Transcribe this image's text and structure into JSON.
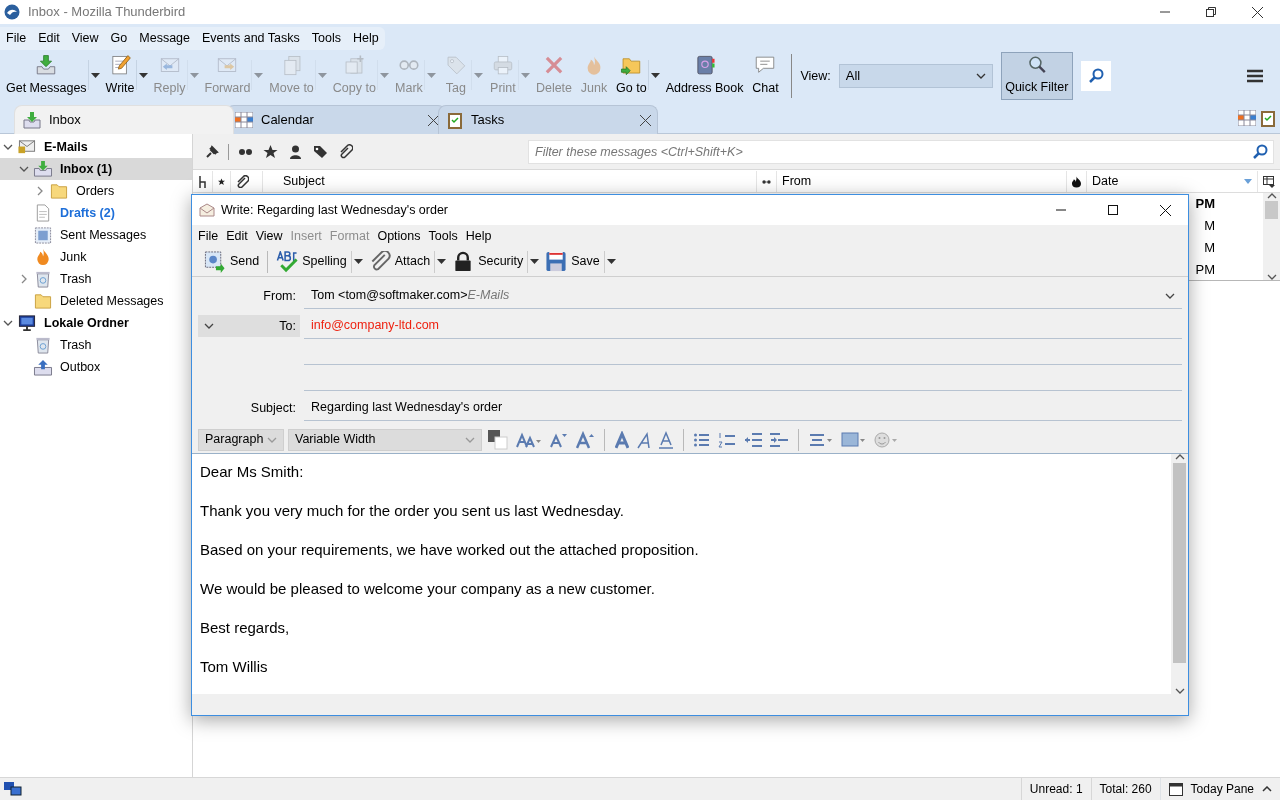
{
  "window": {
    "title": "Inbox - Mozilla Thunderbird"
  },
  "menu": [
    "File",
    "Edit",
    "View",
    "Go",
    "Message",
    "Events and Tasks",
    "Tools",
    "Help"
  ],
  "toolbar": [
    {
      "label": "Get Messages",
      "disabled": false,
      "dropdown": true
    },
    {
      "label": "Write",
      "disabled": false,
      "dropdown": true
    },
    {
      "label": "Reply",
      "disabled": true,
      "dropdown": true
    },
    {
      "label": "Forward",
      "disabled": true,
      "dropdown": true
    },
    {
      "label": "Move to",
      "disabled": true,
      "dropdown": true
    },
    {
      "label": "Copy to",
      "disabled": true,
      "dropdown": true
    },
    {
      "label": "Mark",
      "disabled": true,
      "dropdown": true
    },
    {
      "label": "Tag",
      "disabled": true,
      "dropdown": true
    },
    {
      "label": "Print",
      "disabled": true,
      "dropdown": true
    },
    {
      "label": "Delete",
      "disabled": true,
      "dropdown": false
    },
    {
      "label": "Junk",
      "disabled": true,
      "dropdown": false
    },
    {
      "label": "Go to",
      "disabled": false,
      "dropdown": true
    },
    {
      "label": "Address Book",
      "disabled": false,
      "dropdown": false
    },
    {
      "label": "Chat",
      "disabled": false,
      "dropdown": false
    }
  ],
  "view_filter": {
    "label": "View:",
    "value": "All"
  },
  "quick_filter": {
    "label": "Quick Filter",
    "selected": true
  },
  "tabs": [
    {
      "label": "Inbox",
      "selected": true,
      "closable": false
    },
    {
      "label": "Calendar",
      "selected": false,
      "closable": true
    },
    {
      "label": "Tasks",
      "selected": false,
      "closable": true
    }
  ],
  "folders": [
    {
      "label": "E-Mails",
      "kind": "account",
      "expanded": true,
      "selected": false,
      "children": [
        {
          "label": "Inbox (1)",
          "kind": "inbox",
          "expanded": true,
          "selected": true,
          "unread": true,
          "children": [
            {
              "label": "Orders",
              "kind": "folder",
              "expanded": false,
              "selected": false,
              "unread": false
            }
          ]
        },
        {
          "label": "Drafts (2)",
          "kind": "drafts",
          "selected": false,
          "unread": true
        },
        {
          "label": "Sent Messages",
          "kind": "sent",
          "selected": false,
          "unread": false
        },
        {
          "label": "Junk",
          "kind": "junk",
          "selected": false,
          "unread": false
        },
        {
          "label": "Trash",
          "kind": "trash",
          "expanded": false,
          "selected": false,
          "unread": false
        },
        {
          "label": "Deleted Messages",
          "kind": "folder",
          "selected": false,
          "unread": false
        }
      ]
    },
    {
      "label": "Lokale Ordner",
      "kind": "local",
      "expanded": true,
      "selected": false,
      "children": [
        {
          "label": "Trash",
          "kind": "trash",
          "selected": false,
          "unread": false
        },
        {
          "label": "Outbox",
          "kind": "outbox",
          "selected": false,
          "unread": false
        }
      ]
    }
  ],
  "filter_bar": {
    "placeholder": "Filter these messages <Ctrl+Shift+K>"
  },
  "columns": [
    "Subject",
    "From",
    "Date"
  ],
  "rows": [
    {
      "date": "PM",
      "unread": true
    },
    {
      "date": "M",
      "unread": false
    },
    {
      "date": "M",
      "unread": false
    },
    {
      "date": "PM",
      "unread": false
    }
  ],
  "compose": {
    "title": "Write: Regarding last Wednesday's order",
    "menu": [
      {
        "label": "File",
        "disabled": false
      },
      {
        "label": "Edit",
        "disabled": false
      },
      {
        "label": "View",
        "disabled": false
      },
      {
        "label": "Insert",
        "disabled": true
      },
      {
        "label": "Format",
        "disabled": true
      },
      {
        "label": "Options",
        "disabled": false
      },
      {
        "label": "Tools",
        "disabled": false
      },
      {
        "label": "Help",
        "disabled": false
      }
    ],
    "toolbar": [
      {
        "label": "Send",
        "dropdown": false
      },
      {
        "label": "Spelling",
        "dropdown": true
      },
      {
        "label": "Attach",
        "dropdown": true
      },
      {
        "label": "Security",
        "dropdown": true
      },
      {
        "label": "Save",
        "dropdown": true
      }
    ],
    "from_label": "From:",
    "from_address": "Tom <tom@softmaker.com>",
    "from_identity": "E-Mails",
    "to_label": "To:",
    "recipients": [
      "info@company-ltd.com"
    ],
    "subject_label": "Subject:",
    "subject": "Regarding last Wednesday's order",
    "paragraph_format": "Paragraph",
    "font": "Variable Width",
    "body": [
      "Dear Ms Smith:",
      "Thank you very much for the order you sent us last Wednesday.",
      "Based on your requirements, we have worked out the attached proposition.",
      "We would be pleased to welcome your company as a new customer.",
      "Best regards,",
      "Tom Willis"
    ]
  },
  "status_bar": {
    "unread": "Unread: 1",
    "total": "Total: 260",
    "today_pane": "Today Pane"
  }
}
